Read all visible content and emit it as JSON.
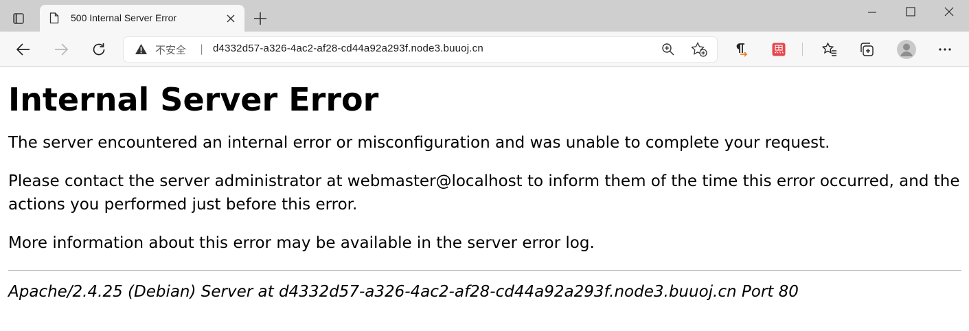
{
  "browser": {
    "tab": {
      "title": "500 Internal Server Error"
    },
    "address_bar": {
      "security_label": "不安全",
      "separator": "|",
      "url": "d4332d57-a326-4ac2-af28-cd44a92a293f.node3.buuoj.cn"
    },
    "icons": {
      "tab_actions": "tab-actions-icon",
      "page": "page-icon",
      "close_tab": "close-icon",
      "new_tab": "plus-icon",
      "minimize": "minimize-icon",
      "maximize": "maximize-icon",
      "close_window": "close-window-icon",
      "back": "back-arrow-icon",
      "forward": "forward-arrow-icon",
      "refresh": "refresh-icon",
      "warning": "warning-icon",
      "zoom": "zoom-icon",
      "add_favorite": "add-favorite-icon",
      "translate_extension": "pilcrow-extension-icon",
      "red_extension": "red-extension-icon",
      "favorites": "favorites-icon",
      "collections": "collections-icon",
      "profile": "profile-avatar-icon",
      "more": "more-icon"
    },
    "colors": {
      "tabstrip": "#cfcfcf",
      "toolbar": "#f7f7f7",
      "red_extension": "#e5484d",
      "pilcrow_arrow": "#e8812a"
    }
  },
  "page": {
    "heading": "Internal Server Error",
    "paragraph1": "The server encountered an internal error or misconfiguration and was unable to complete your request.",
    "paragraph2": "Please contact the server administrator at webmaster@localhost to inform them of the time this error occurred, and the actions you performed just before this error.",
    "paragraph3": "More information about this error may be available in the server error log.",
    "signature": "Apache/2.4.25 (Debian) Server at d4332d57-a326-4ac2-af28-cd44a92a293f.node3.buuoj.cn Port 80"
  }
}
